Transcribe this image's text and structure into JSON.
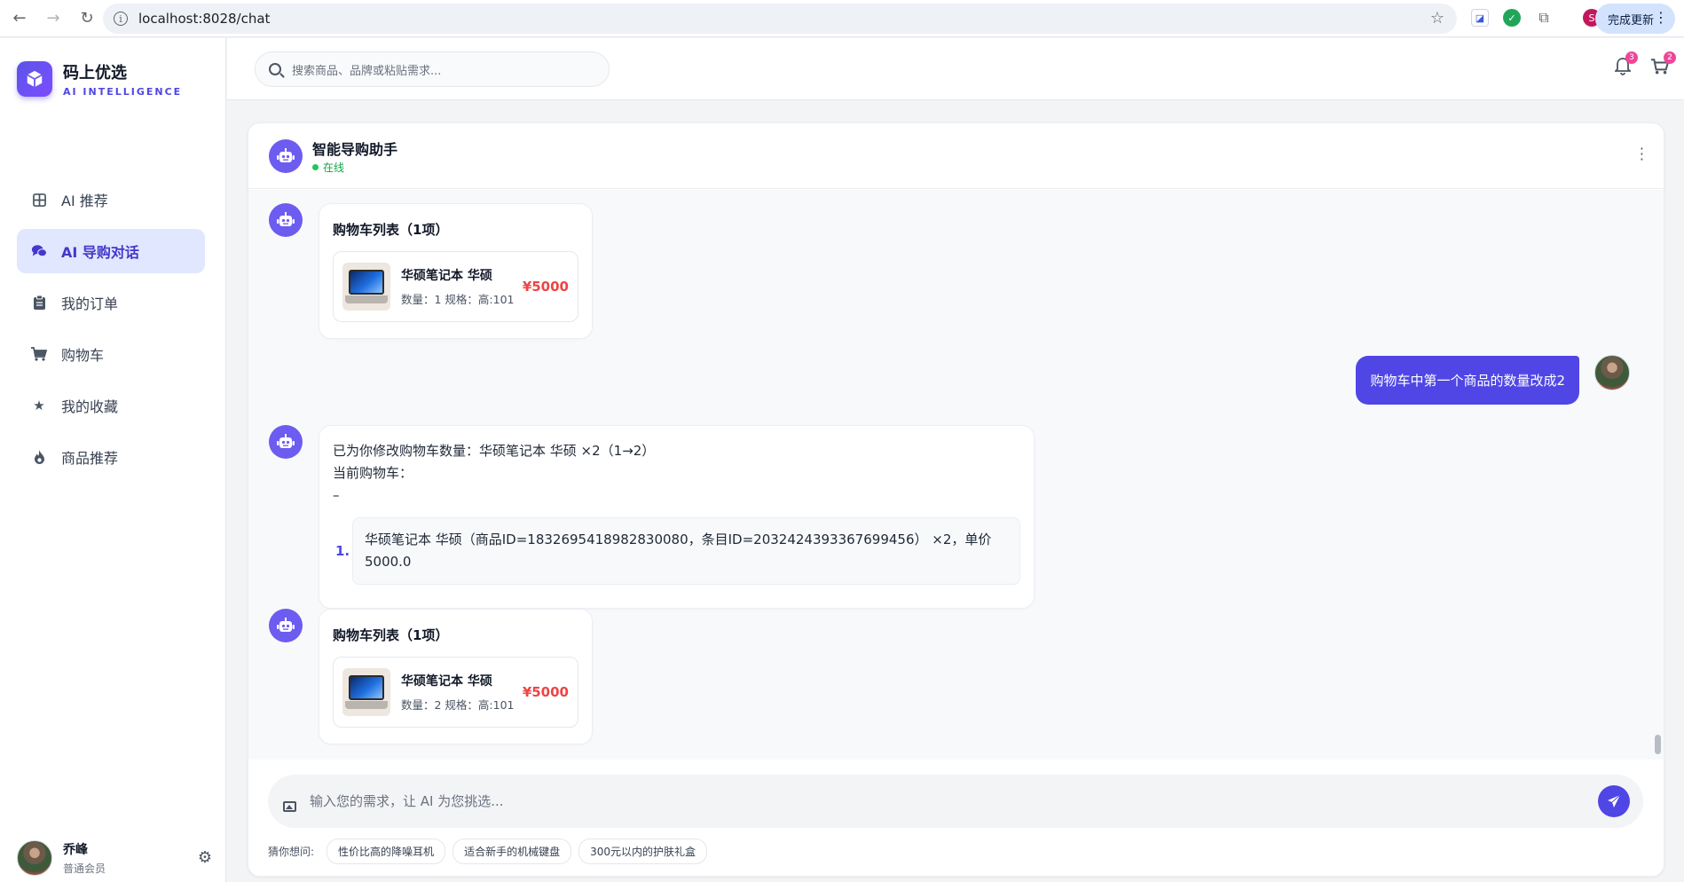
{
  "browser": {
    "url": "localhost:8028/chat",
    "update_label": "完成更新",
    "profile_initial": "S"
  },
  "brand": {
    "title": "码上优选",
    "subtitle": "AI INTELLIGENCE"
  },
  "sidebar": {
    "items": [
      {
        "label": "AI 推荐",
        "icon": "grid-icon"
      },
      {
        "label": "AI 导购对话",
        "icon": "chat-icon"
      },
      {
        "label": "我的订单",
        "icon": "clipboard-icon"
      },
      {
        "label": "购物车",
        "icon": "cart-icon"
      },
      {
        "label": "我的收藏",
        "icon": "star-icon"
      },
      {
        "label": "商品推荐",
        "icon": "fire-icon"
      }
    ],
    "active_index": 1
  },
  "user": {
    "name": "乔峰",
    "role": "普通会员"
  },
  "header": {
    "search_placeholder": "搜索商品、品牌或粘贴需求...",
    "notification_count": "3",
    "cart_count": "2"
  },
  "chat": {
    "assistant_name": "智能导购助手",
    "status": "在线",
    "messages": [
      {
        "type": "cart",
        "title": "购物车列表（1项）",
        "item": {
          "name": "华硕笔记本 华硕",
          "meta": "数量：1 规格：高:101",
          "price": "¥5000"
        }
      },
      {
        "type": "user",
        "text": "购物车中第一个商品的数量改成2"
      },
      {
        "type": "text",
        "line1": "已为你修改购物车数量：华硕笔记本 华硕 ×2（1→2）",
        "line2": "当前购物车：",
        "line3": "–",
        "list_num": "1.",
        "list_item": "华硕笔记本 华硕（商品ID=1832695418982830080，条目ID=2032424393367699456） ×2，单价 5000.0"
      },
      {
        "type": "cart",
        "title": "购物车列表（1项）",
        "item": {
          "name": "华硕笔记本 华硕",
          "meta": "数量：2 规格：高:101",
          "price": "¥5000"
        }
      }
    ]
  },
  "composer": {
    "placeholder": "输入您的需求，让 AI 为您挑选...",
    "suggest_label": "猜你想问:",
    "suggestions": [
      "性价比高的降噪耳机",
      "适合新手的机械键盘",
      "300元以内的护肤礼盒"
    ]
  },
  "colors": {
    "accent": "#4f46e5",
    "price": "#ef4444",
    "online": "#22c55e",
    "badge": "#ec4899"
  }
}
